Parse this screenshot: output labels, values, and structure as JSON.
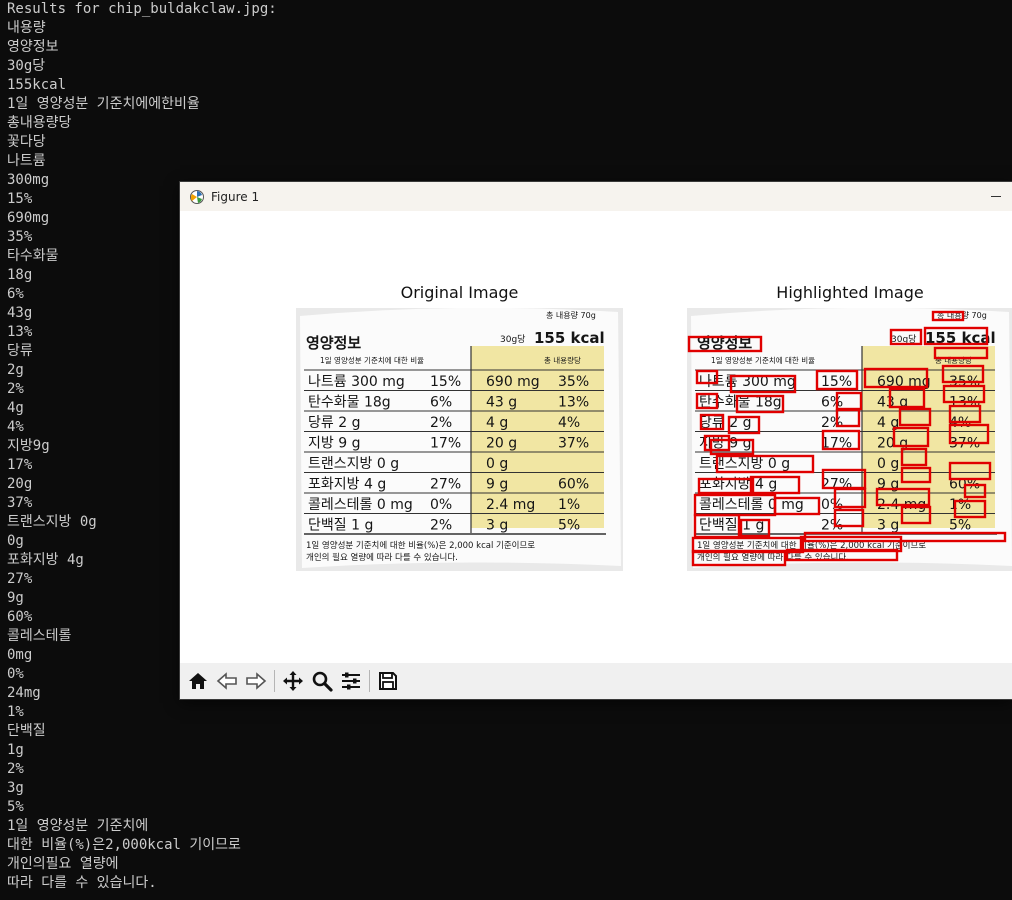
{
  "terminal": {
    "lines": [
      "Results for chip_buldakclaw.jpg:",
      "내용량",
      "영양정보",
      "30g당",
      "155kcal",
      "1일 영양성분 기준치에에한비율",
      "총내용량당",
      "꽃다당",
      "나트륨",
      "300mg",
      "15%",
      "690mg",
      "35%",
      "타수화물",
      "18g",
      "6%",
      "43g",
      "13%",
      "당류",
      "2g",
      "2%",
      "4g",
      "4%",
      "지방9g",
      "17%",
      "20g",
      "37%",
      "트랜스지방 0g",
      "0g",
      "포화지방 4g",
      "27%",
      "9g",
      "60%",
      "콜레스테롤",
      "0mg",
      "0%",
      "24mg",
      "1%",
      "단백질",
      "1g",
      "2%",
      "3g",
      "5%",
      "1일 영양성분 기준치에",
      "대한 비율(%)은2,000kcal 기이므로",
      "개인의필요 열량에",
      "따라 다를 수 있습니다."
    ]
  },
  "window": {
    "title": "Figure 1",
    "minimize_glyph": "—"
  },
  "figure": {
    "left_title": "Original Image",
    "right_title": "Highlighted Image"
  },
  "label": {
    "top_right": "총 내용량 70g",
    "header": "영양정보",
    "per_serving": "30g당",
    "kcal": "155 kcal",
    "ratio_header": "1일 영양성분 기준치에 대한 비율",
    "total_header": "총 내용량당",
    "rows": [
      {
        "name": "나트륨 300 mg",
        "pct": "15%",
        "total": "690 mg",
        "tpct": "35%"
      },
      {
        "name": "탄수화물 18g",
        "pct": "6%",
        "total": "43 g",
        "tpct": "13%"
      },
      {
        "name": "당류 2 g",
        "pct": "2%",
        "total": "4 g",
        "tpct": "4%"
      },
      {
        "name": "지방 9 g",
        "pct": "17%",
        "total": "20 g",
        "tpct": "37%"
      },
      {
        "name": "트랜스지방 0 g",
        "pct": "",
        "total": "0 g",
        "tpct": ""
      },
      {
        "name": "포화지방 4 g",
        "pct": "27%",
        "total": "9 g",
        "tpct": "60%"
      },
      {
        "name": "콜레스테롤 0 mg",
        "pct": "0%",
        "total": "2.4 mg",
        "tpct": "1%"
      },
      {
        "name": "단백질 1 g",
        "pct": "2%",
        "total": "3 g",
        "tpct": "5%"
      }
    ],
    "footnote_1": "1일 영양성분 기준치에 대한 비율(%)은 2,000 kcal 기준이므로",
    "footnote_2": "개인의 필요 열량에 따라 다를 수 있습니다."
  },
  "toolbar": {
    "buttons": [
      "home-icon",
      "back-icon",
      "forward-icon",
      "pan-icon",
      "zoom-icon",
      "configure-icon",
      "save-icon"
    ]
  },
  "colors": {
    "terminal_bg": "#0c0c0c",
    "terminal_text": "#cccccc",
    "highlight_box": "#e00000",
    "label_yellow": "#f1e6a3"
  }
}
